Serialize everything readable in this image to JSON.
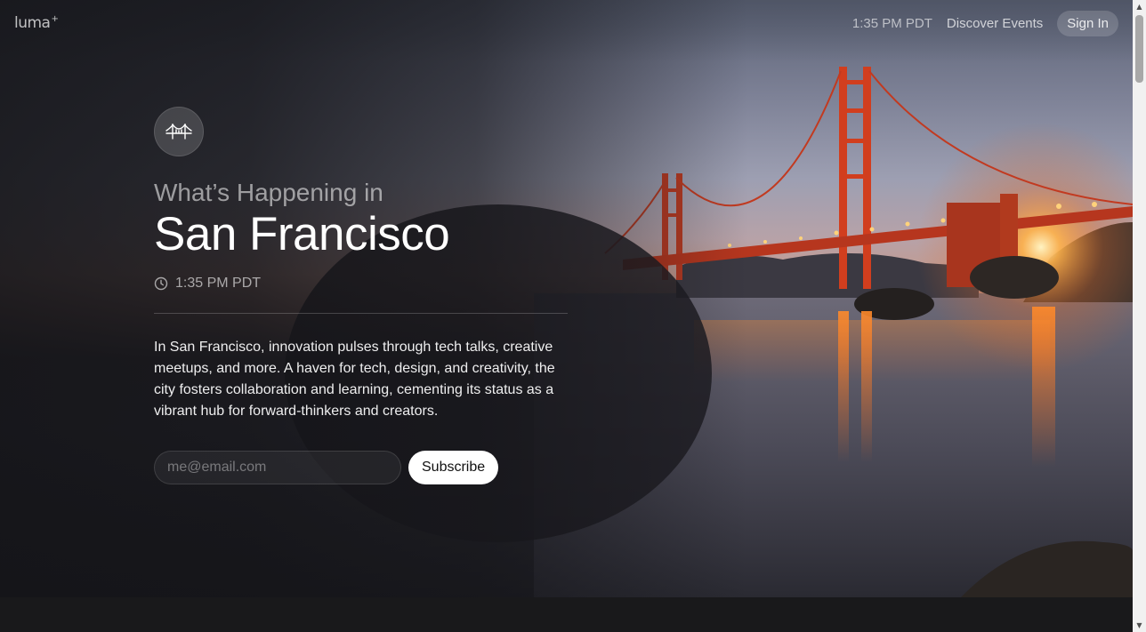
{
  "nav": {
    "logo": "luma",
    "logo_mark": "+",
    "time": "1:35 PM PDT",
    "discover_label": "Discover Events",
    "signin_label": "Sign In"
  },
  "hero": {
    "subtitle": "What’s Happening in",
    "title": "San Francisco",
    "local_time": "1:35 PM PDT",
    "description": "In San Francisco, innovation pulses through tech talks, creative meetups, and more. A haven for tech, design, and creativity, the city fosters collaboration and learning, cementing its status as a vibrant hub for forward-thinkers and creators.",
    "city_icon": "golden-gate-bridge-icon"
  },
  "subscribe": {
    "email_placeholder": "me@email.com",
    "button_label": "Subscribe"
  },
  "colors": {
    "page_bg": "#19191b",
    "button_bg": "#ffffff",
    "bridge": "#c9381c",
    "lights": "#ffb347"
  }
}
